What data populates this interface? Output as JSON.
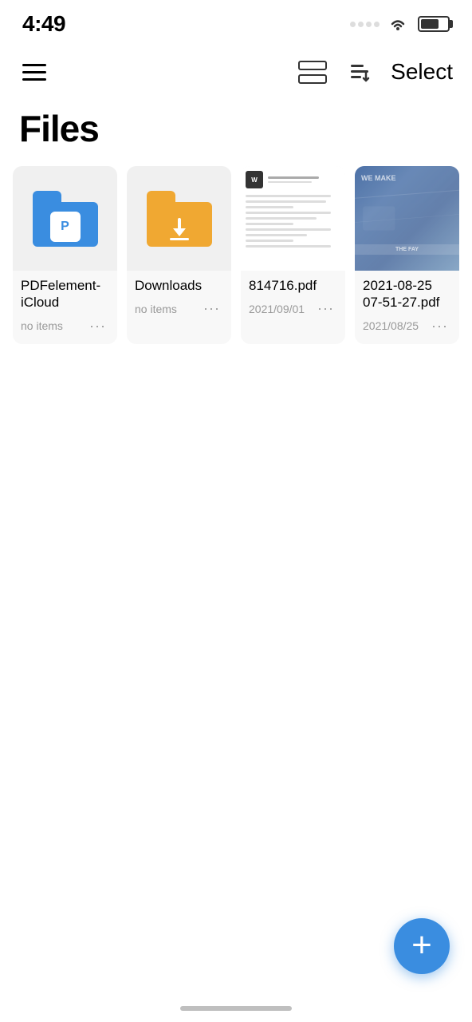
{
  "statusBar": {
    "time": "4:49",
    "batteryLevel": 70
  },
  "navBar": {
    "selectLabel": "Select"
  },
  "pageTitle": "Files",
  "files": [
    {
      "id": "pdfelement-icloud",
      "name": "PDFelement-iCloud",
      "type": "folder-blue",
      "meta": "no items",
      "date": ""
    },
    {
      "id": "downloads",
      "name": "Downloads",
      "type": "folder-orange",
      "meta": "no items",
      "date": ""
    },
    {
      "id": "814716-pdf",
      "name": "814716.pdf",
      "type": "pdf",
      "meta": "",
      "date": "2021/09/01"
    },
    {
      "id": "2021-08-25-pdf",
      "name": "2021-08-25 07-51-27.pdf",
      "type": "image",
      "meta": "",
      "date": "2021/08/25"
    }
  ],
  "fab": {
    "label": "+"
  }
}
